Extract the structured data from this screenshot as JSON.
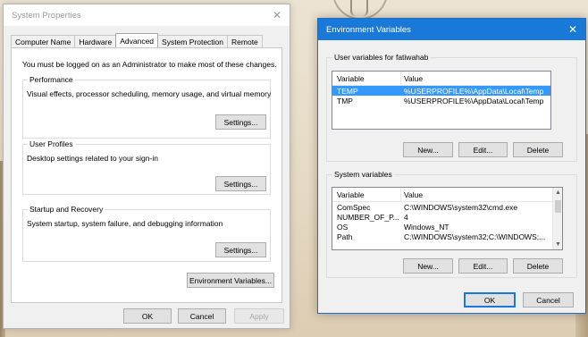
{
  "system_properties": {
    "title": "System Properties",
    "tabs": [
      "Computer Name",
      "Hardware",
      "Advanced",
      "System Protection",
      "Remote"
    ],
    "active_tab": "Advanced",
    "admin_note": "You must be logged on as an Administrator to make most of these changes.",
    "performance": {
      "label": "Performance",
      "description": "Visual effects, processor scheduling, memory usage, and virtual memory",
      "button": "Settings..."
    },
    "user_profiles": {
      "label": "User Profiles",
      "description": "Desktop settings related to your sign-in",
      "button": "Settings..."
    },
    "startup_recovery": {
      "label": "Startup and Recovery",
      "description": "System startup, system failure, and debugging information",
      "button": "Settings..."
    },
    "env_button": "Environment Variables...",
    "ok": "OK",
    "cancel": "Cancel",
    "apply": "Apply"
  },
  "environment_variables": {
    "title": "Environment Variables",
    "user_group_label": "User variables for fatiwahab",
    "columns": {
      "variable": "Variable",
      "value": "Value"
    },
    "user_vars": [
      {
        "variable": "TEMP",
        "value": "%USERPROFILE%\\AppData\\Local\\Temp"
      },
      {
        "variable": "TMP",
        "value": "%USERPROFILE%\\AppData\\Local\\Temp"
      }
    ],
    "user_buttons": {
      "new": "New...",
      "edit": "Edit...",
      "delete": "Delete"
    },
    "system_group_label": "System variables",
    "system_vars": [
      {
        "variable": "ComSpec",
        "value": "C:\\WINDOWS\\system32\\cmd.exe"
      },
      {
        "variable": "NUMBER_OF_P...",
        "value": "4"
      },
      {
        "variable": "OS",
        "value": "Windows_NT"
      },
      {
        "variable": "Path",
        "value": "C:\\WINDOWS\\system32;C:\\WINDOWS;..."
      }
    ],
    "system_buttons": {
      "new": "New...",
      "edit": "Edit...",
      "delete": "Delete"
    },
    "ok": "OK",
    "cancel": "Cancel"
  },
  "colors": {
    "accent": "#1979d8",
    "selection": "#3399ff"
  }
}
